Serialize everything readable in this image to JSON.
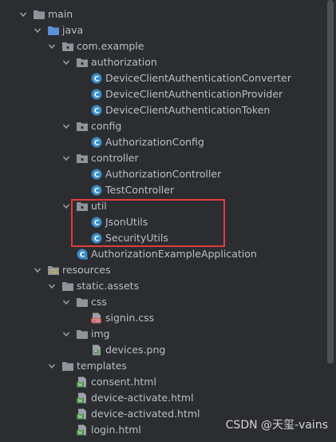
{
  "tree": {
    "nodes": [
      {
        "label": "main",
        "depth": 0,
        "expanded": true,
        "type": "folder"
      },
      {
        "label": "java",
        "depth": 1,
        "expanded": true,
        "type": "folder-src"
      },
      {
        "label": "com.example",
        "depth": 2,
        "expanded": true,
        "type": "package"
      },
      {
        "label": "authorization",
        "depth": 3,
        "expanded": true,
        "type": "package"
      },
      {
        "label": "DeviceClientAuthenticationConverter",
        "depth": 4,
        "type": "class"
      },
      {
        "label": "DeviceClientAuthenticationProvider",
        "depth": 4,
        "type": "class"
      },
      {
        "label": "DeviceClientAuthenticationToken",
        "depth": 4,
        "type": "class"
      },
      {
        "label": "config",
        "depth": 3,
        "expanded": true,
        "type": "package"
      },
      {
        "label": "AuthorizationConfig",
        "depth": 4,
        "type": "class"
      },
      {
        "label": "controller",
        "depth": 3,
        "expanded": true,
        "type": "package"
      },
      {
        "label": "AuthorizationController",
        "depth": 4,
        "type": "class"
      },
      {
        "label": "TestController",
        "depth": 4,
        "type": "class"
      },
      {
        "label": "util",
        "depth": 3,
        "expanded": true,
        "type": "package"
      },
      {
        "label": "JsonUtils",
        "depth": 4,
        "type": "class"
      },
      {
        "label": "SecurityUtils",
        "depth": 4,
        "type": "class"
      },
      {
        "label": "AuthorizationExampleApplication",
        "depth": 3,
        "type": "app-class"
      },
      {
        "label": "resources",
        "depth": 1,
        "expanded": true,
        "type": "folder-res"
      },
      {
        "label": "static.assets",
        "depth": 2,
        "expanded": true,
        "type": "folder"
      },
      {
        "label": "css",
        "depth": 3,
        "expanded": true,
        "type": "folder"
      },
      {
        "label": "signin.css",
        "depth": 4,
        "type": "css-file"
      },
      {
        "label": "img",
        "depth": 3,
        "expanded": true,
        "type": "folder"
      },
      {
        "label": "devices.png",
        "depth": 4,
        "type": "image-file"
      },
      {
        "label": "templates",
        "depth": 2,
        "expanded": true,
        "type": "folder"
      },
      {
        "label": "consent.html",
        "depth": 3,
        "type": "html-file"
      },
      {
        "label": "device-activate.html",
        "depth": 3,
        "type": "html-file"
      },
      {
        "label": "device-activated.html",
        "depth": 3,
        "type": "html-file"
      },
      {
        "label": "login.html",
        "depth": 3,
        "type": "html-file"
      }
    ]
  },
  "watermark": "CSDN @天玺-vains",
  "colors": {
    "background": "#2b2d30",
    "text": "#bbbec4",
    "class_icon": "#3b8ec7",
    "highlight_box": "#e33b3b",
    "html_icon": "#4e9a4e"
  }
}
